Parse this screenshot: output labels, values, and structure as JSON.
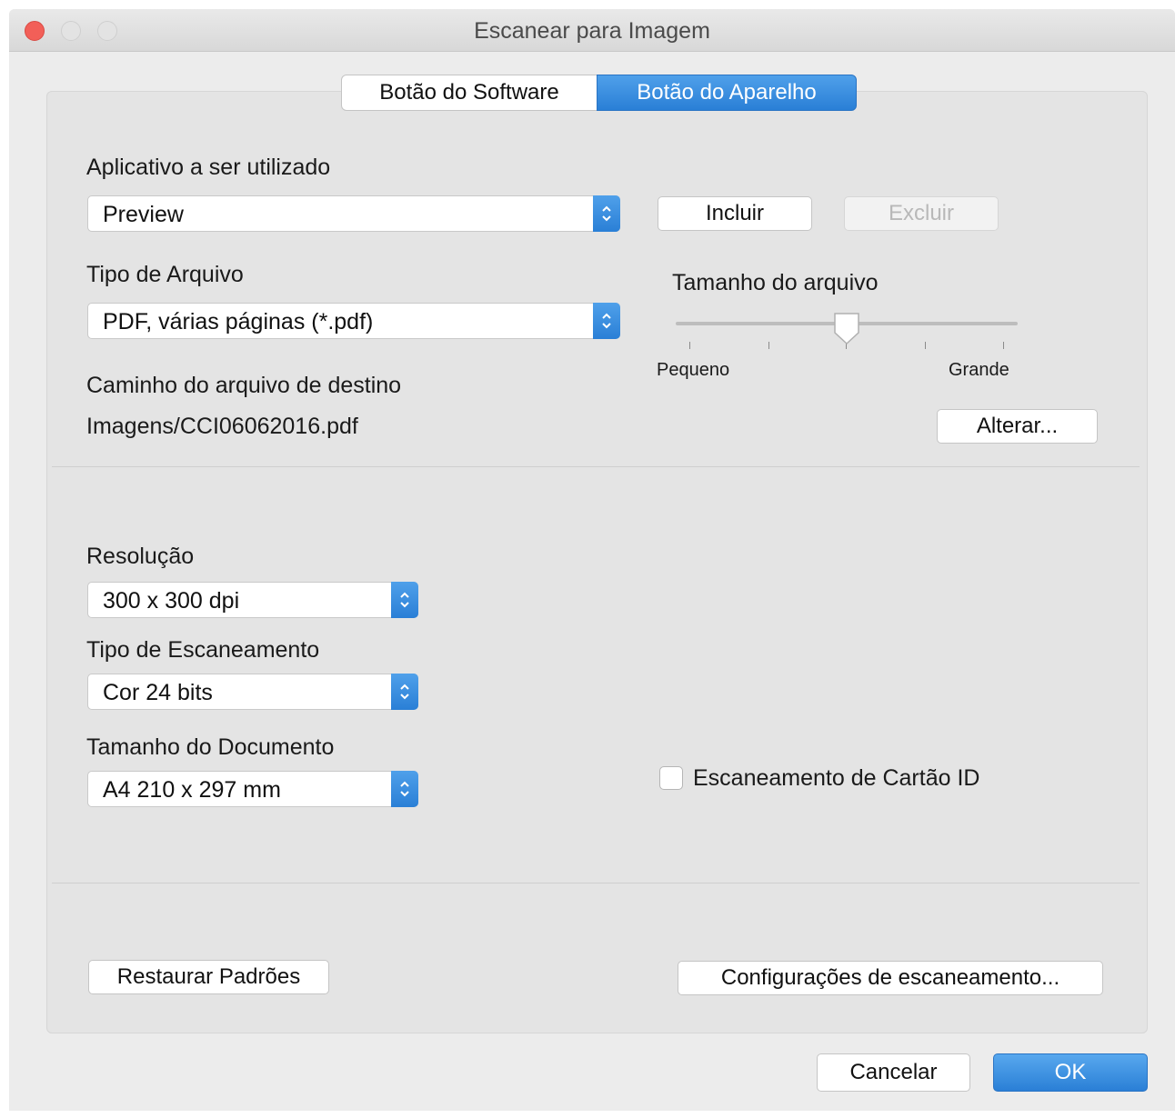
{
  "window": {
    "title": "Escanear para Imagem"
  },
  "tabs": {
    "software": "Botão do Software",
    "device": "Botão do Aparelho",
    "selected": "device"
  },
  "app": {
    "label": "Aplicativo a ser utilizado",
    "value": "Preview",
    "add_button": "Incluir",
    "remove_button": "Excluir"
  },
  "file_type": {
    "label": "Tipo de Arquivo",
    "value": "PDF, várias páginas (*.pdf)"
  },
  "file_size": {
    "label": "Tamanho do arquivo",
    "min_label": "Pequeno",
    "max_label": "Grande",
    "level": 0.5
  },
  "destination": {
    "label": "Caminho do arquivo de destino",
    "path": "Imagens/CCI06062016.pdf",
    "change_button": "Alterar..."
  },
  "resolution": {
    "label": "Resolução",
    "value": "300 x 300 dpi"
  },
  "scan_type": {
    "label": "Tipo de Escaneamento",
    "value": "Cor 24 bits"
  },
  "doc_size": {
    "label": "Tamanho do Documento",
    "value": "A4 210 x 297 mm"
  },
  "id_card": {
    "label": "Escaneamento de Cartão ID",
    "checked": false
  },
  "footer": {
    "restore_button": "Restaurar Padrões",
    "settings_button": "Configurações de escaneamento...",
    "cancel_button": "Cancelar",
    "ok_button": "OK"
  },
  "colors": {
    "accent": "#2a7fd6",
    "close": "#f25f58"
  }
}
